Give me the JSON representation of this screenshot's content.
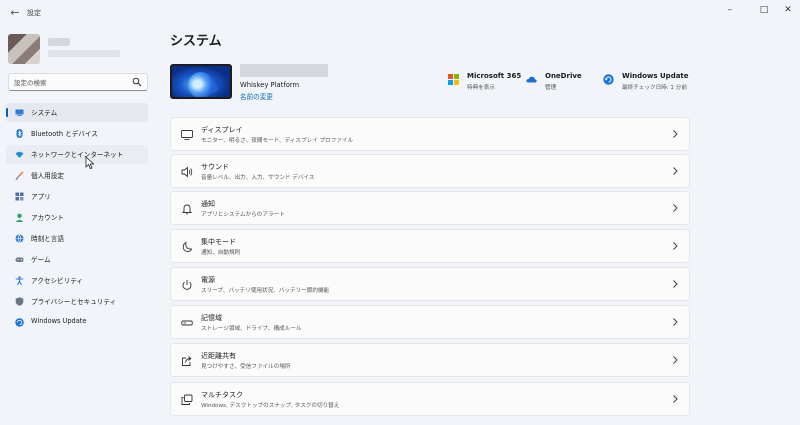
{
  "window": {
    "title": "設定",
    "back_icon": "back-arrow-icon",
    "controls": [
      "minimize-icon",
      "maximize-icon",
      "close-icon"
    ]
  },
  "sidebar": {
    "search": {
      "placeholder": "設定の検索",
      "value": ""
    },
    "items": [
      {
        "label": "システム",
        "icon": "system-icon",
        "active": true
      },
      {
        "label": "Bluetooth とデバイス",
        "icon": "bluetooth-icon"
      },
      {
        "label": "ネットワークとインターネット",
        "icon": "wifi-icon",
        "hover": true
      },
      {
        "label": "個人用設定",
        "icon": "brush-icon"
      },
      {
        "label": "アプリ",
        "icon": "apps-icon"
      },
      {
        "label": "アカウント",
        "icon": "account-icon"
      },
      {
        "label": "時刻と言語",
        "icon": "globe-icon"
      },
      {
        "label": "ゲーム",
        "icon": "gamepad-icon"
      },
      {
        "label": "アクセシビリティ",
        "icon": "accessibility-icon"
      },
      {
        "label": "プライバシーとセキュリティ",
        "icon": "shield-icon"
      },
      {
        "label": "Windows Update",
        "icon": "update-icon"
      }
    ]
  },
  "main": {
    "title": "システム",
    "device": {
      "model": "Whiskey Platform",
      "rename_label": "名前の変更"
    },
    "quick": [
      {
        "title": "Microsoft 365",
        "sub": "特典を表示",
        "icon": "microsoft-logo-icon"
      },
      {
        "title": "OneDrive",
        "sub": "管理",
        "icon": "onedrive-icon"
      },
      {
        "title": "Windows Update",
        "sub": "最終チェック日時: 1 分前",
        "icon": "windows-update-icon"
      }
    ],
    "cards": [
      {
        "title": "ディスプレイ",
        "desc": "モニター、明るさ、夜間モード、ディスプレイ プロファイル",
        "icon": "display-icon"
      },
      {
        "title": "サウンド",
        "desc": "音量レベル、出力、入力、サウンド デバイス",
        "icon": "speaker-icon"
      },
      {
        "title": "通知",
        "desc": "アプリとシステムからのアラート",
        "icon": "bell-icon"
      },
      {
        "title": "集中モード",
        "desc": "通知、自動規則",
        "icon": "moon-icon"
      },
      {
        "title": "電源",
        "desc": "スリープ、バッテリ使用状況、バッテリー節約機能",
        "icon": "power-icon"
      },
      {
        "title": "記憶域",
        "desc": "ストレージ領域、ドライブ、構成ルール",
        "icon": "storage-icon"
      },
      {
        "title": "近距離共有",
        "desc": "見つけやすさ、受信ファイルの場所",
        "icon": "share-icon"
      },
      {
        "title": "マルチタスク",
        "desc": "Windows, デスクトップのスナップ, タスクの切り替え",
        "icon": "multitask-icon"
      }
    ]
  },
  "colors": {
    "accent": "#005fb8",
    "link": "#0067c0",
    "background": "#f1f4f8",
    "card": "#fbfbfc"
  }
}
